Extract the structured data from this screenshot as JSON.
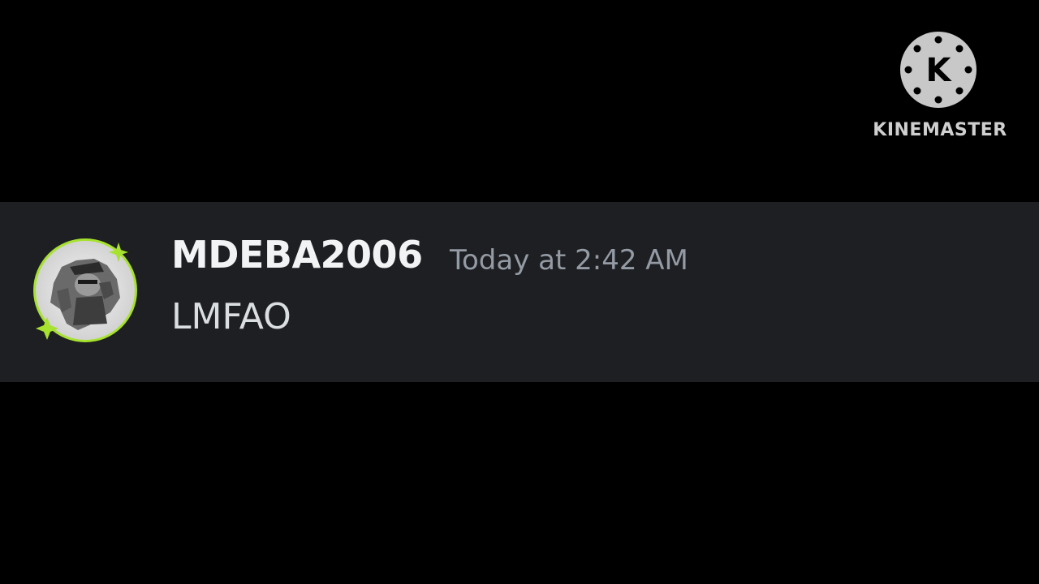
{
  "watermark": {
    "logo_letter": "K",
    "text": "KINEMASTER",
    "icon": "kinemaster-logo-icon"
  },
  "message": {
    "author": "MDEBA2006",
    "timestamp": "Today at 2:42 AM",
    "content": "LMFAO",
    "avatar_icon": "user-avatar-icon"
  },
  "colors": {
    "background": "#000000",
    "message_band": "#1e1f22",
    "username": "#f2f3f5",
    "timestamp": "#949ba4",
    "message_text": "#dbdee1",
    "avatar_ring": "#a6e22e",
    "watermark": "#cfcfcf"
  }
}
